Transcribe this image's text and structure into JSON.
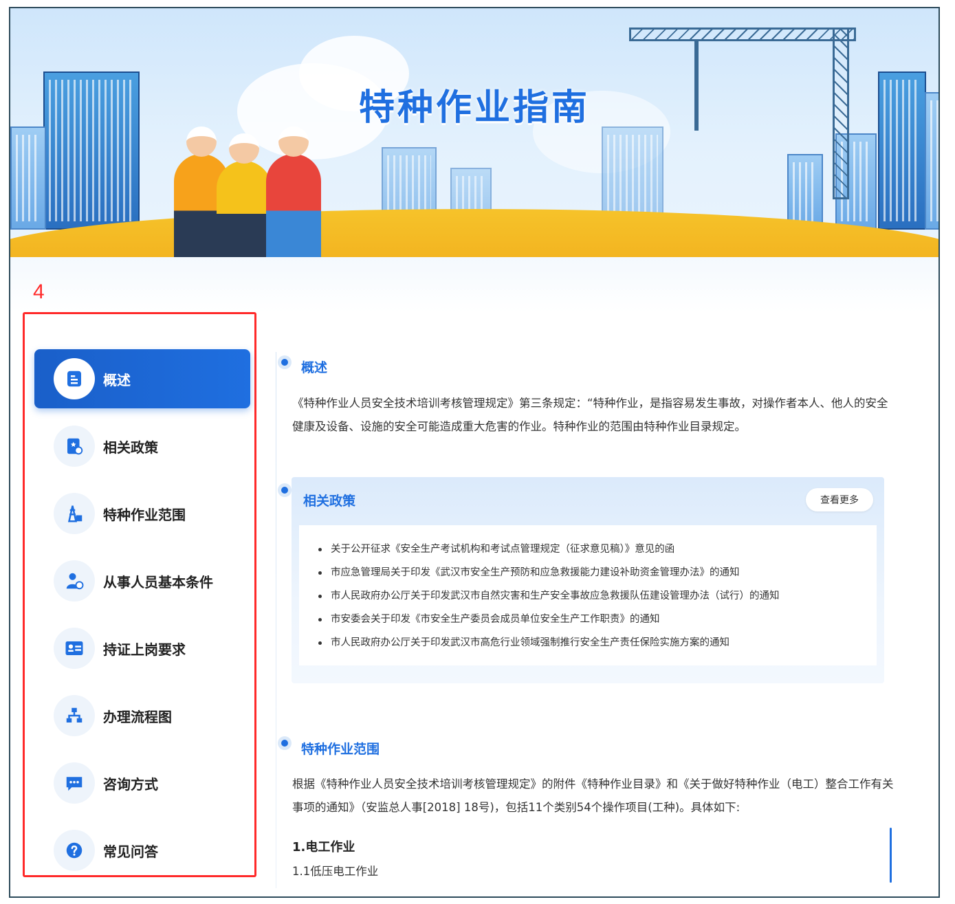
{
  "banner": {
    "title": "特种作业指南"
  },
  "annotation": {
    "label": "4"
  },
  "sidebar": {
    "items": [
      {
        "label": "概述",
        "icon": "document-icon",
        "active": true
      },
      {
        "label": "相关政策",
        "icon": "policy-icon",
        "active": false
      },
      {
        "label": "特种作业范围",
        "icon": "tower-icon",
        "active": false
      },
      {
        "label": "从事人员基本条件",
        "icon": "user-icon",
        "active": false
      },
      {
        "label": "持证上岗要求",
        "icon": "id-card-icon",
        "active": false
      },
      {
        "label": "办理流程图",
        "icon": "flowchart-icon",
        "active": false
      },
      {
        "label": "咨询方式",
        "icon": "chat-icon",
        "active": false
      },
      {
        "label": "常见问答",
        "icon": "question-icon",
        "active": false
      }
    ]
  },
  "overview": {
    "title": "概述",
    "text": "《特种作业人员安全技术培训考核管理规定》第三条规定：“特种作业，是指容易发生事故，对操作者本人、他人的安全健康及设备、设施的安全可能造成重大危害的作业。特种作业的范围由特种作业目录规定。"
  },
  "policies": {
    "title": "相关政策",
    "more_label": "查看更多",
    "items": [
      "关于公开征求《安全生产考试机构和考试点管理规定（征求意见稿）》意见的函",
      "市应急管理局关于印发《武汉市安全生产预防和应急救援能力建设补助资金管理办法》的通知",
      "市人民政府办公厅关于印发武汉市自然灾害和生产安全事故应急救援队伍建设管理办法（试行）的通知",
      "市安委会关于印发《市安全生产委员会成员单位安全生产工作职责》的通知",
      "市人民政府办公厅关于印发武汉市高危行业领域强制推行安全生产责任保险实施方案的通知"
    ]
  },
  "scope": {
    "title": "特种作业范围",
    "text": "根据《特种作业人员安全技术培训考核管理规定》的附件《特种作业目录》和《关于做好特种作业（电工）整合工作有关事项的通知》（安监总人事[2018] 18号)，包括11个类别54个操作项目(工种)。具体如下:",
    "sub_heading": "1.电工作业",
    "sub_item": "1.1低压电工作业"
  },
  "colors": {
    "accent": "#1f6fe0",
    "annotation": "#ff2a2a"
  }
}
